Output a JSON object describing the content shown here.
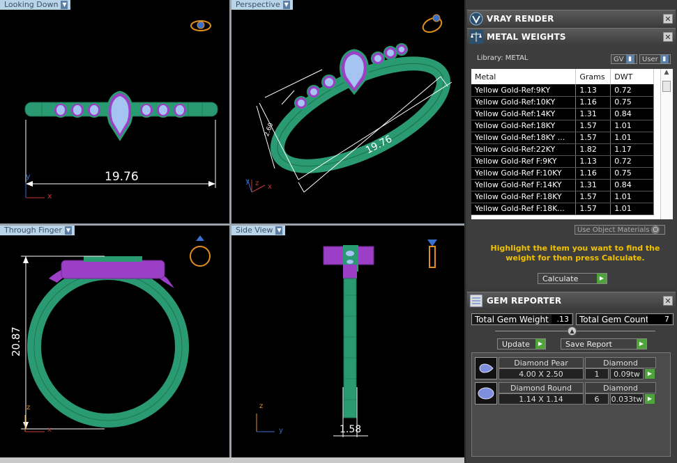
{
  "viewports": {
    "top_left": {
      "label": "Looking Down",
      "dimension": "19.76",
      "axes": [
        "y",
        "x"
      ]
    },
    "top_right": {
      "label": "Perspective",
      "dimension_long": "19.76",
      "dimension_short": "2.60",
      "axes": [
        "z",
        "x",
        "y"
      ]
    },
    "bottom_left": {
      "label": "Through Finger",
      "dimension": "20.87",
      "axes": [
        "z",
        "x"
      ]
    },
    "bottom_right": {
      "label": "Side View",
      "dimension": "1.58",
      "axes": [
        "z",
        "y"
      ]
    }
  },
  "panel": {
    "vray": {
      "title": "VRAY RENDER",
      "close": "✕"
    },
    "metal": {
      "title": "METAL WEIGHTS",
      "close": "✕",
      "library_label": "Library: METAL",
      "gv_label": "GV",
      "user_label": "User",
      "columns": [
        "Metal",
        "Grams",
        "DWT"
      ],
      "rows": [
        [
          "Yellow Gold-Ref:9KY",
          "1.13",
          "0.72"
        ],
        [
          "Yellow Gold-Ref:10KY",
          "1.16",
          "0.75"
        ],
        [
          "Yellow Gold-Ref:14KY",
          "1.31",
          "0.84"
        ],
        [
          "Yellow Gold-Ref:18KY",
          "1.57",
          "1.01"
        ],
        [
          "Yellow Gold-Ref:18KY ...",
          "1.57",
          "1.01"
        ],
        [
          "Yellow Gold-Ref:22KY",
          "1.82",
          "1.17"
        ],
        [
          "Yellow Gold-Ref F:9KY",
          "1.13",
          "0.72"
        ],
        [
          "Yellow Gold-Ref F:10KY",
          "1.16",
          "0.75"
        ],
        [
          "Yellow Gold-Ref F:14KY",
          "1.31",
          "0.84"
        ],
        [
          "Yellow Gold-Ref F:18KY",
          "1.57",
          "1.01"
        ],
        [
          "Yellow Gold-Ref F:18K...",
          "1.57",
          "1.01"
        ]
      ],
      "use_object_materials": "Use Object Materials",
      "hint": "Highlight the item you want to find the weight for then press Calculate.",
      "calculate_label": "Calculate"
    },
    "gem": {
      "title": "GEM REPORTER",
      "close": "✕",
      "total_weight_label": "Total Gem Weight",
      "total_weight_value": ".13",
      "total_count_label": "Total Gem Count",
      "total_count_value": "7",
      "update_label": "Update",
      "save_report_label": "Save Report",
      "gems": [
        {
          "name": "Diamond Pear",
          "size": "4.00 X 2.50",
          "type": "Diamond",
          "count": "1",
          "weight": "0.09tw"
        },
        {
          "name": "Diamond Round",
          "size": "1.14 X 1.14",
          "type": "Diamond",
          "count": "6",
          "weight": "0.033tw"
        }
      ]
    }
  },
  "colors": {
    "metal_green": "#2a9a72",
    "head_purple": "#9b3fc6",
    "gem_blue": "#a6c4f2",
    "dimension_white": "#ffffff",
    "tab_blue": "#b9d4e6",
    "hint_yellow": "#f2c200",
    "go_green": "#4ea33b"
  }
}
